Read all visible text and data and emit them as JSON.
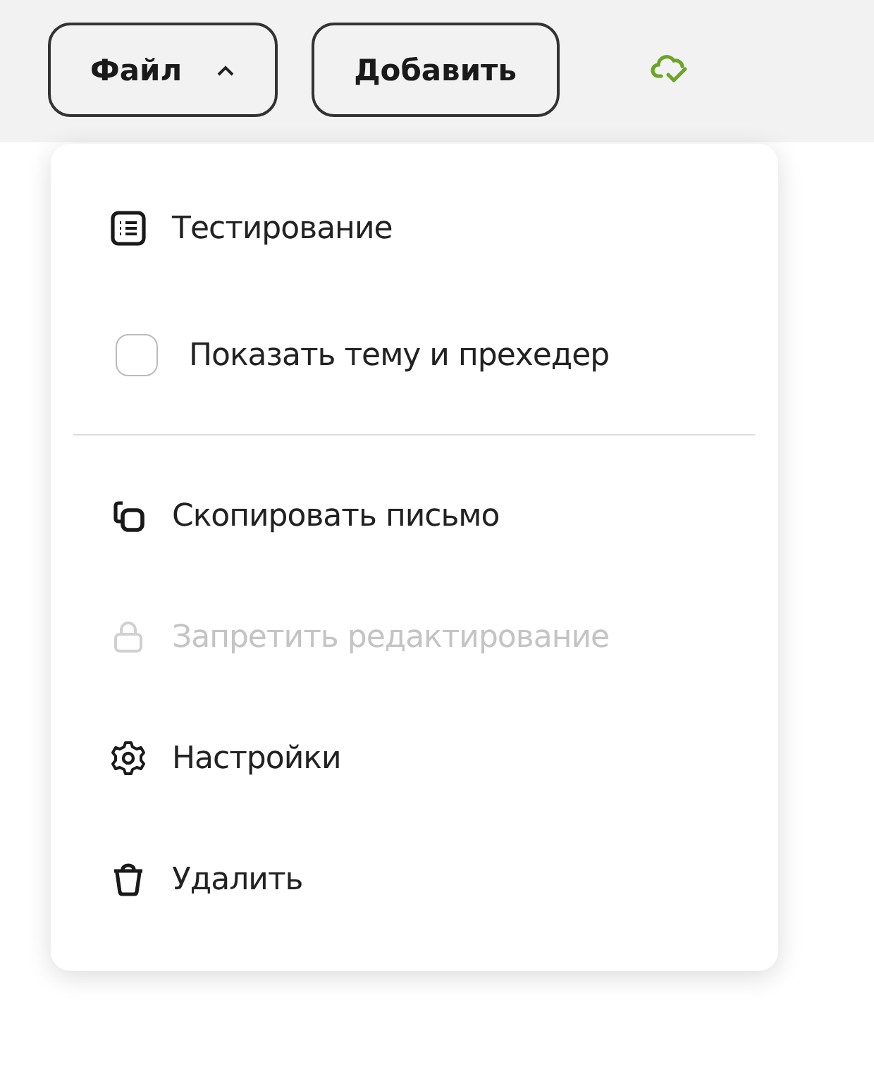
{
  "toolbar": {
    "file_button": {
      "label": "Файл",
      "expanded": true
    },
    "add_button": {
      "label": "Добавить"
    }
  },
  "menu": {
    "items": [
      {
        "kind": "action",
        "label": "Тестирование",
        "disabled": false
      },
      {
        "kind": "checkbox",
        "label": "Показать тему и прехедер",
        "checked": false,
        "disabled": false
      },
      {
        "kind": "divider"
      },
      {
        "kind": "action",
        "label": "Скопировать письмо",
        "disabled": false
      },
      {
        "kind": "action",
        "label": "Запретить редактирование",
        "disabled": true
      },
      {
        "kind": "action",
        "label": "Настройки",
        "disabled": false
      },
      {
        "kind": "action",
        "label": "Удалить",
        "disabled": false
      }
    ]
  }
}
